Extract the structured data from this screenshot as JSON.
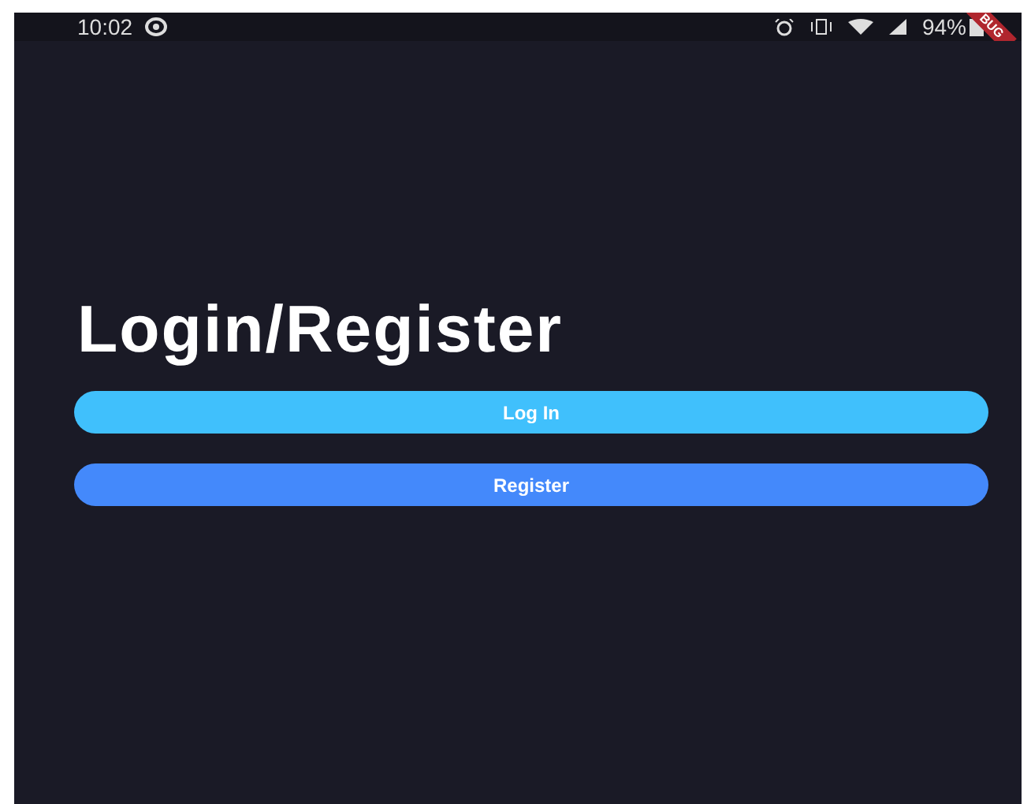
{
  "status_bar": {
    "time": "10:02",
    "battery": "94%"
  },
  "debug_banner": "BUG",
  "title": "Login/Register",
  "buttons": [
    {
      "label": "Log In",
      "kind": "primary"
    },
    {
      "label": "Register",
      "kind": "secondary"
    }
  ]
}
